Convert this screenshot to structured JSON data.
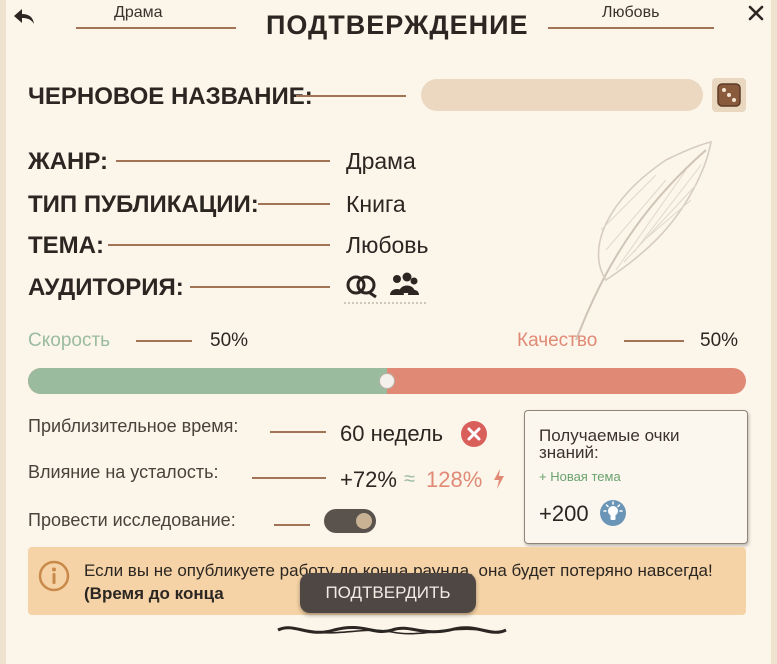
{
  "header": {
    "back_icon": "back-arrow-icon",
    "left_tab": "Драма",
    "title": "ПОДТВЕРЖДЕНИЕ",
    "right_tab": "Любовь",
    "close_icon": "close-icon"
  },
  "draft": {
    "label": "ЧЕРНОВОЕ НАЗВАНИЕ:",
    "input_value": "",
    "dice_icon": "dice-icon"
  },
  "details": [
    {
      "label": "ЖАНР:",
      "value": "Драма"
    },
    {
      "label": "ТИП ПУБЛИКАЦИИ:",
      "value": "Книга"
    },
    {
      "label": "ТЕМА:",
      "value": "Любовь"
    },
    {
      "label": "АУДИТОРИЯ:",
      "icons": [
        "couple-icon",
        "group-icon"
      ]
    }
  ],
  "balance": {
    "speed_label": "Скорость",
    "speed_value": "50%",
    "quality_label": "Качество",
    "quality_value": "50%",
    "slider_fraction": 0.5,
    "speed_color": "#9bbb9f",
    "quality_color": "#e08a76"
  },
  "stats": {
    "time_label": "Приблизительное время:",
    "time_value": "60 недель",
    "fatigue_label": "Влияние на усталость:",
    "fatigue_value": "+72%",
    "fatigue_approx": "≈",
    "fatigue_extra": "128%",
    "research_label": "Провести исследование:",
    "research_toggle_on": false
  },
  "knowledge": {
    "title": "Получаемые очки знаний:",
    "note": "+ Новая тема",
    "points": "+200",
    "points_icon": "lightbulb-icon"
  },
  "warning": {
    "text": "Если вы не опубликуете работу до конца раунда, она будет потеряно навсегда!",
    "bold": "(Время до конца"
  },
  "confirm_button": "ПОДТВЕРДИТЬ"
}
